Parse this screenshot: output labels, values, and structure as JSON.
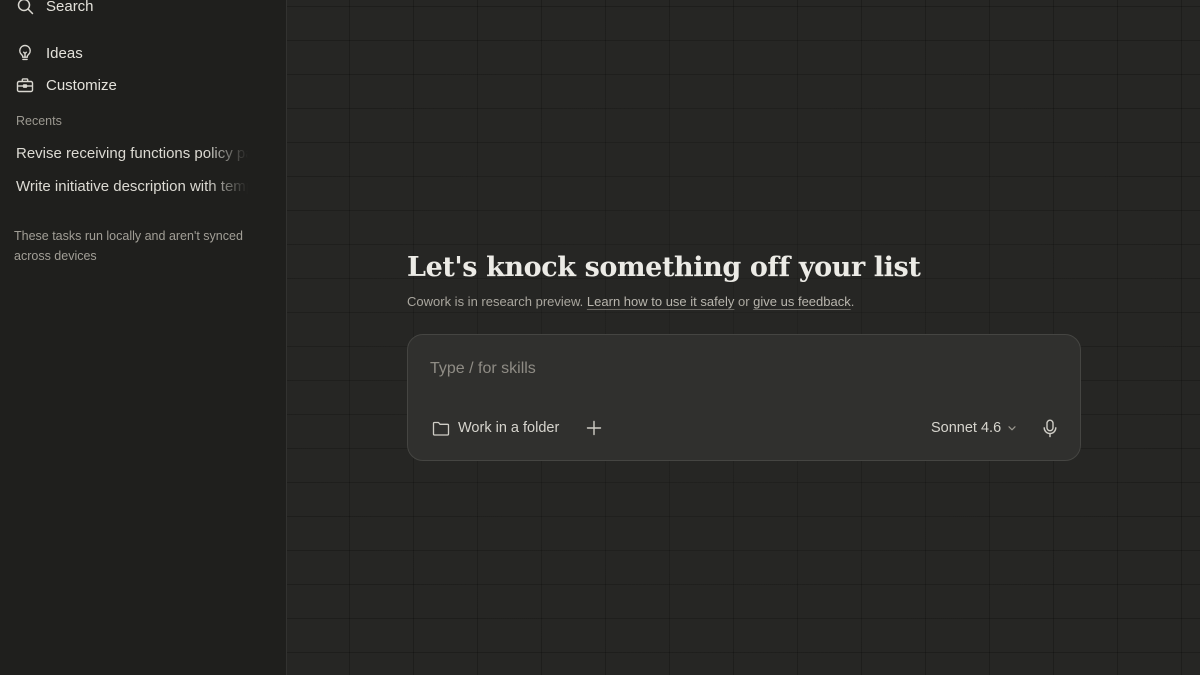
{
  "sidebar": {
    "search_label": "Search",
    "items": [
      {
        "label": "Ideas",
        "icon": "lightbulb-icon"
      },
      {
        "label": "Customize",
        "icon": "toolbox-icon"
      }
    ],
    "recents_label": "Recents",
    "recents": [
      {
        "label": "Revise receiving functions policy page"
      },
      {
        "label": "Write initiative description with template"
      }
    ],
    "note": "These tasks run locally and aren't synced across devices"
  },
  "main": {
    "title": "Let's knock something off your list",
    "subtitle_prefix": "Cowork is in research preview.",
    "subtitle_link1": "Learn how to use it safely",
    "subtitle_mid": "or",
    "subtitle_link2": "give us feedback",
    "subtitle_suffix": "."
  },
  "composer": {
    "placeholder": "Type / for skills",
    "folder_label": "Work in a folder",
    "model_label": "Sonnet 4.6",
    "icons": {
      "folder": "folder-icon",
      "add": "plus-icon",
      "model_dropdown": "chevron-down-icon",
      "voice": "microphone-icon"
    }
  },
  "colors": {
    "sidebar_bg": "#1f1f1d",
    "main_bg": "#262624",
    "composer_bg": "#30302e",
    "text": "#e8e6e0"
  }
}
